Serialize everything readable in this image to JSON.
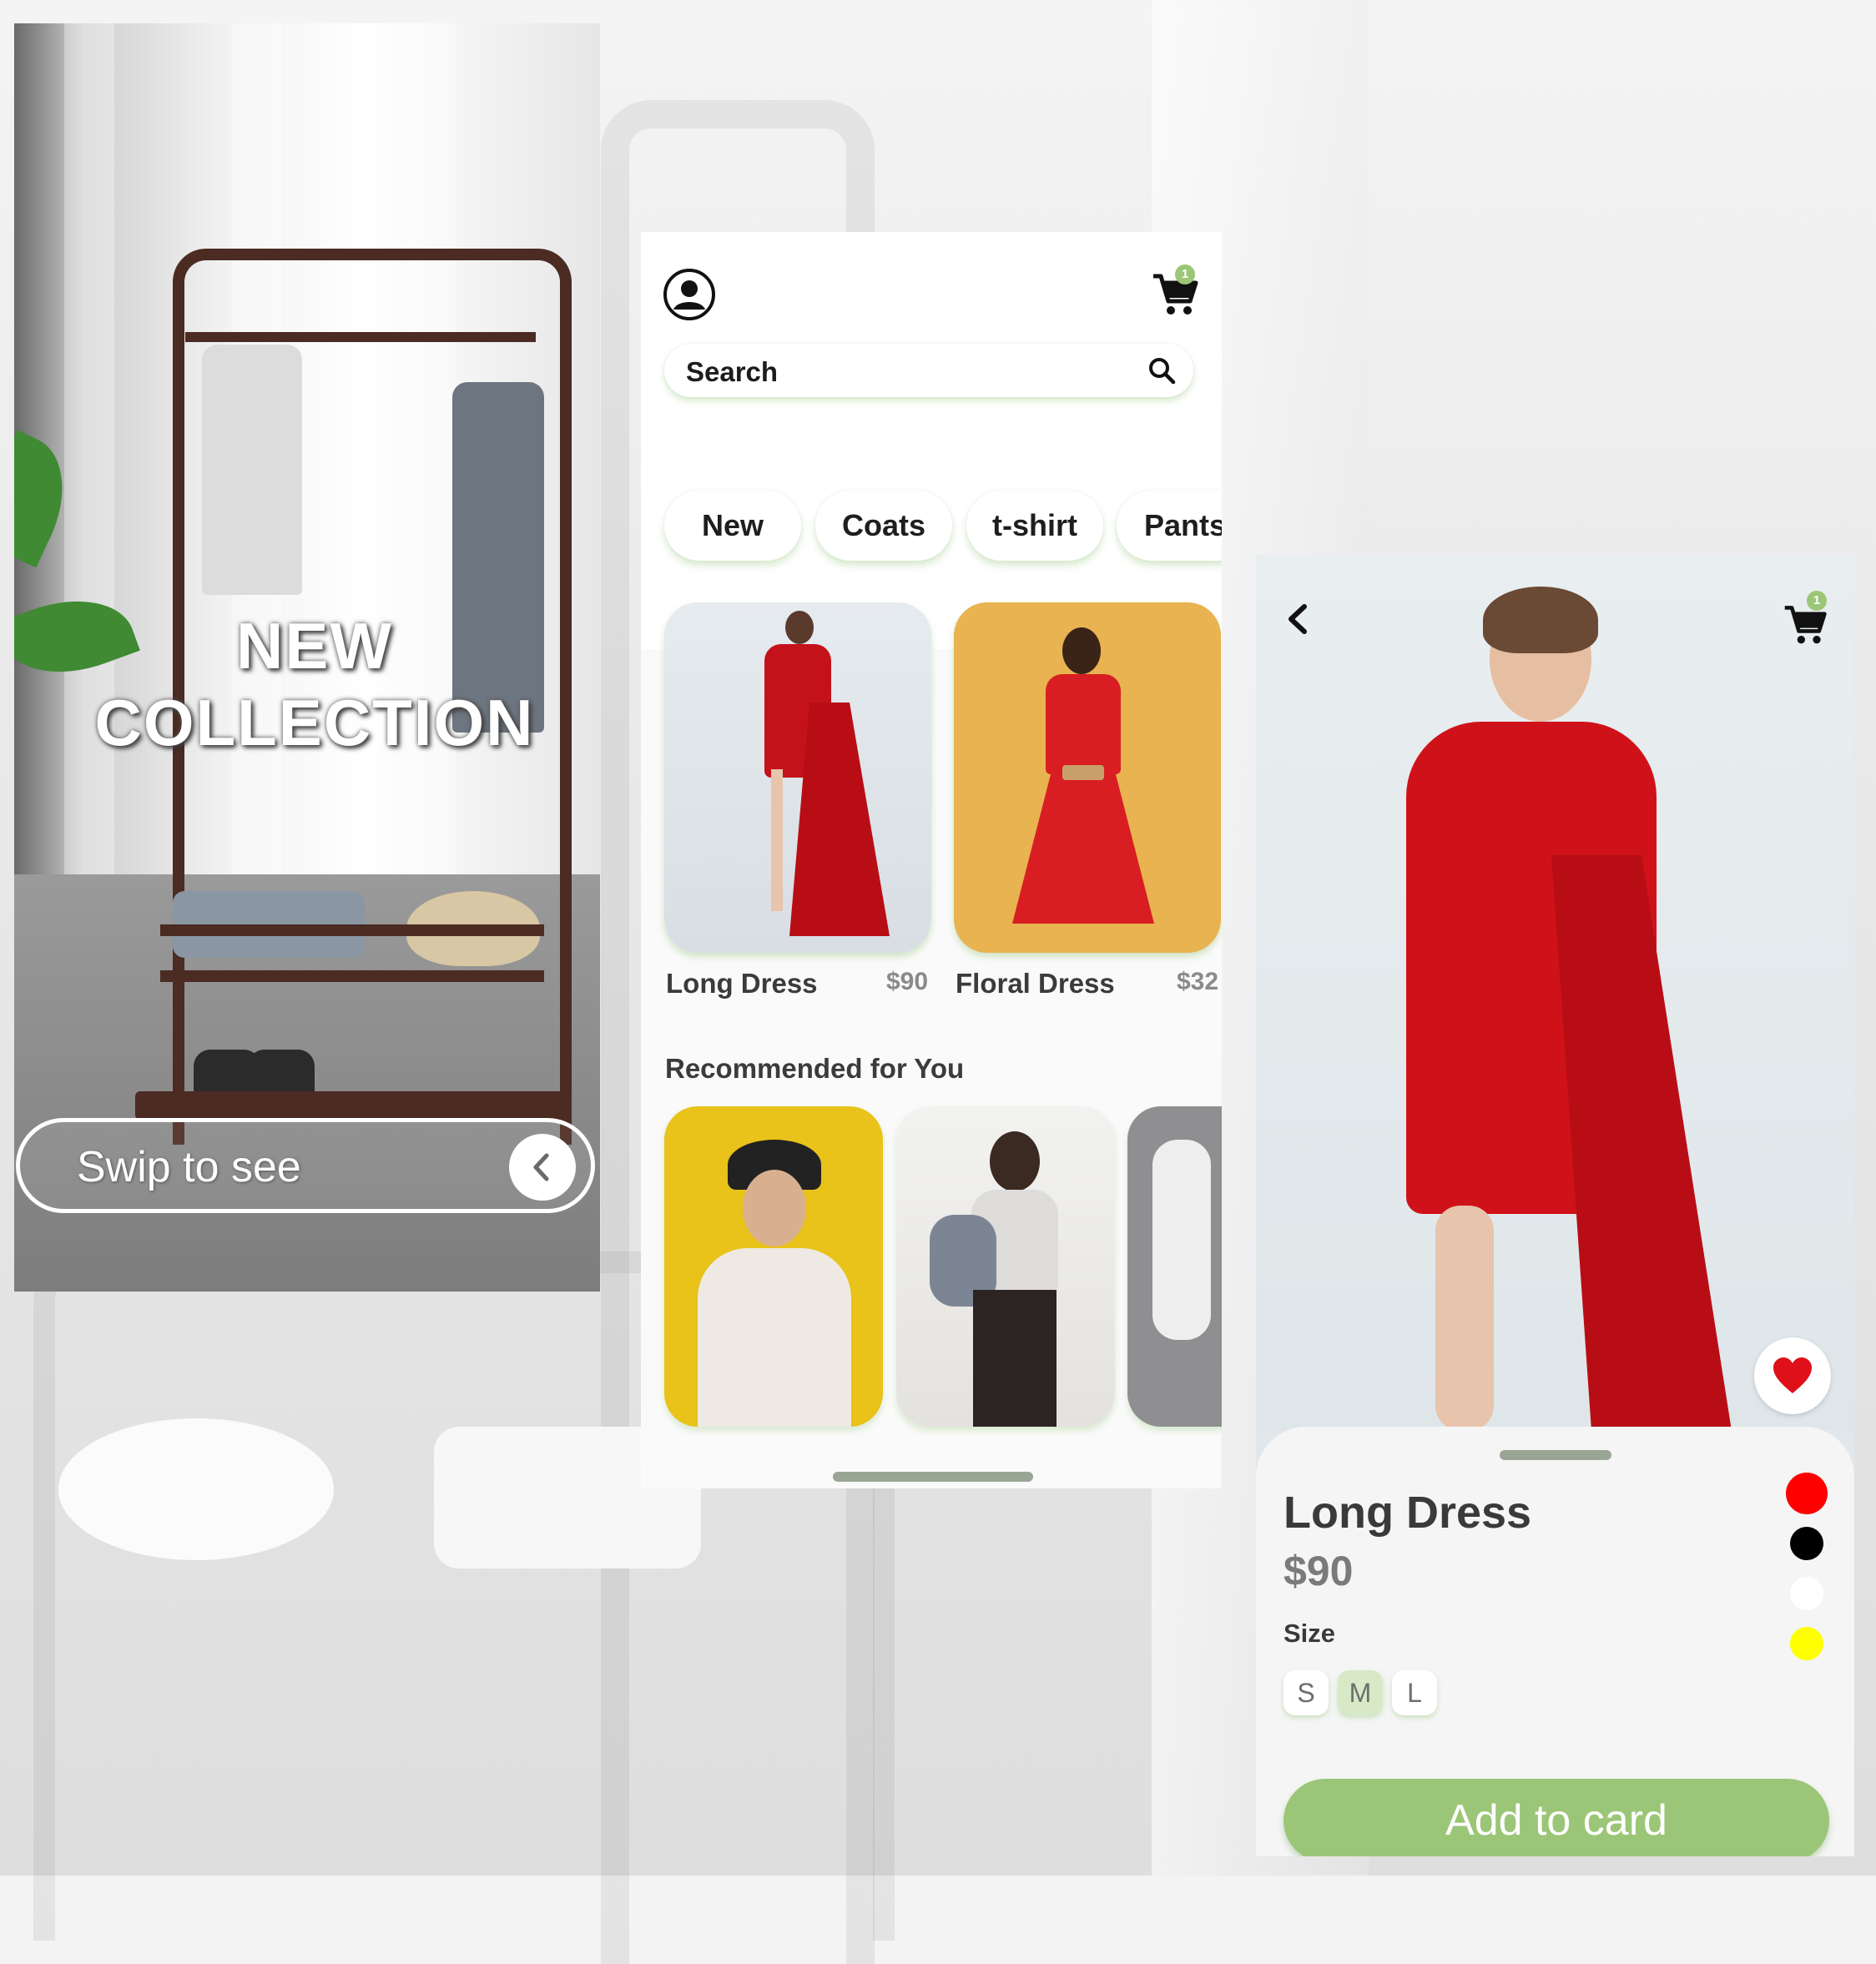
{
  "onboarding": {
    "title_line1": "NEW",
    "title_line2": "COLLECTION",
    "swipe_label": "Swip to see"
  },
  "home": {
    "cart_count": "1",
    "search": {
      "placeholder": "Search"
    },
    "categories": [
      "New",
      "Coats",
      "t-shirt",
      "Pants"
    ],
    "products": [
      {
        "name": "Long Dress",
        "price": "$90"
      },
      {
        "name": "Floral Dress",
        "price": "$32"
      }
    ],
    "recommended_title": "Recommended for You"
  },
  "detail": {
    "cart_count": "1",
    "name": "Long Dress",
    "price": "$90",
    "size_label": "Size",
    "sizes": [
      "S",
      "M",
      "L"
    ],
    "selected_size": "M",
    "colors": [
      "#ff0000",
      "#000000",
      "#ffffff",
      "#ffff00"
    ],
    "add_button": "Add to card"
  },
  "theme": {
    "accent": "#9bc677",
    "favorite": "#e0101a"
  }
}
